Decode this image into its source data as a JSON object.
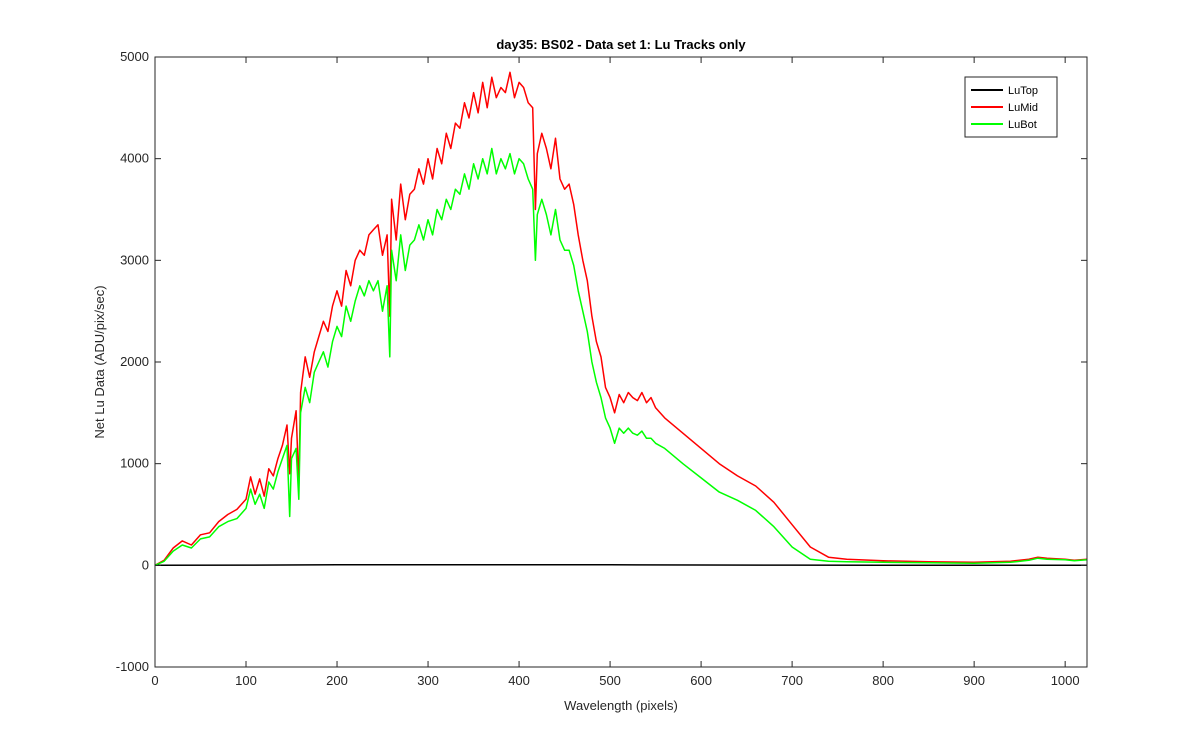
{
  "chart_data": {
    "type": "line",
    "title": "day35: BS02 - Data set 1: Lu Tracks only",
    "xlabel": "Wavelength (pixels)",
    "ylabel": "Net Lu Data (ADU/pix/sec)",
    "xlim": [
      0,
      1024
    ],
    "ylim": [
      -1000,
      5000
    ],
    "xticks": [
      0,
      100,
      200,
      300,
      400,
      500,
      600,
      700,
      800,
      900,
      1000
    ],
    "yticks": [
      -1000,
      0,
      1000,
      2000,
      3000,
      4000,
      5000
    ],
    "grid": false,
    "legend_position": "top-right",
    "series": [
      {
        "name": "LuTop",
        "color": "#000000",
        "x": [
          0,
          100,
          200,
          300,
          400,
          500,
          600,
          700,
          800,
          900,
          1024
        ],
        "y": [
          0,
          2,
          5,
          6,
          6,
          5,
          3,
          2,
          1,
          1,
          1
        ]
      },
      {
        "name": "LuMid",
        "color": "#ff0000",
        "x": [
          0,
          10,
          20,
          30,
          40,
          50,
          60,
          70,
          80,
          90,
          100,
          105,
          110,
          115,
          120,
          125,
          130,
          135,
          140,
          145,
          148,
          150,
          155,
          158,
          160,
          165,
          170,
          175,
          180,
          185,
          190,
          195,
          200,
          205,
          210,
          215,
          220,
          225,
          230,
          235,
          240,
          245,
          250,
          255,
          258,
          260,
          265,
          270,
          275,
          280,
          285,
          290,
          295,
          300,
          305,
          310,
          315,
          320,
          325,
          330,
          335,
          340,
          345,
          350,
          355,
          360,
          365,
          370,
          375,
          380,
          385,
          390,
          395,
          400,
          405,
          410,
          415,
          418,
          420,
          425,
          430,
          435,
          440,
          445,
          450,
          455,
          460,
          465,
          470,
          475,
          480,
          485,
          490,
          495,
          500,
          505,
          510,
          515,
          520,
          525,
          530,
          535,
          540,
          545,
          550,
          560,
          580,
          600,
          620,
          640,
          660,
          680,
          700,
          720,
          740,
          760,
          800,
          850,
          900,
          940,
          960,
          970,
          980,
          1000,
          1010,
          1024
        ],
        "y": [
          0,
          50,
          170,
          240,
          200,
          300,
          320,
          430,
          500,
          550,
          650,
          870,
          700,
          850,
          680,
          950,
          880,
          1050,
          1180,
          1380,
          900,
          1250,
          1520,
          780,
          1700,
          2050,
          1850,
          2100,
          2250,
          2400,
          2300,
          2550,
          2700,
          2550,
          2900,
          2750,
          3000,
          3100,
          3050,
          3250,
          3300,
          3350,
          3050,
          3250,
          2450,
          3600,
          3200,
          3750,
          3400,
          3650,
          3700,
          3900,
          3750,
          4000,
          3800,
          4100,
          3950,
          4250,
          4100,
          4350,
          4300,
          4550,
          4400,
          4650,
          4450,
          4750,
          4500,
          4800,
          4600,
          4700,
          4650,
          4850,
          4600,
          4750,
          4700,
          4550,
          4500,
          3500,
          4050,
          4250,
          4100,
          3900,
          4200,
          3800,
          3700,
          3750,
          3550,
          3250,
          3000,
          2800,
          2450,
          2200,
          2050,
          1750,
          1650,
          1500,
          1680,
          1600,
          1700,
          1650,
          1620,
          1700,
          1600,
          1650,
          1550,
          1450,
          1300,
          1150,
          1000,
          880,
          780,
          620,
          400,
          180,
          80,
          60,
          45,
          35,
          30,
          40,
          60,
          80,
          70,
          60,
          50,
          60
        ]
      },
      {
        "name": "LuBot",
        "color": "#00ff00",
        "x": [
          0,
          10,
          20,
          30,
          40,
          50,
          60,
          70,
          80,
          90,
          100,
          105,
          110,
          115,
          120,
          125,
          130,
          135,
          140,
          145,
          148,
          150,
          155,
          158,
          160,
          165,
          170,
          175,
          180,
          185,
          190,
          195,
          200,
          205,
          210,
          215,
          220,
          225,
          230,
          235,
          240,
          245,
          250,
          255,
          258,
          260,
          265,
          270,
          275,
          280,
          285,
          290,
          295,
          300,
          305,
          310,
          315,
          320,
          325,
          330,
          335,
          340,
          345,
          350,
          355,
          360,
          365,
          370,
          375,
          380,
          385,
          390,
          395,
          400,
          405,
          410,
          415,
          418,
          420,
          425,
          430,
          435,
          440,
          445,
          450,
          455,
          460,
          465,
          470,
          475,
          480,
          485,
          490,
          495,
          500,
          505,
          510,
          515,
          520,
          525,
          530,
          535,
          540,
          545,
          550,
          560,
          580,
          600,
          620,
          640,
          660,
          680,
          700,
          720,
          740,
          760,
          800,
          850,
          900,
          940,
          960,
          970,
          980,
          1000,
          1010,
          1024
        ],
        "y": [
          0,
          40,
          140,
          200,
          170,
          260,
          280,
          380,
          430,
          460,
          560,
          750,
          600,
          700,
          560,
          820,
          750,
          920,
          1050,
          1180,
          480,
          1050,
          1150,
          650,
          1500,
          1750,
          1600,
          1900,
          2000,
          2100,
          1950,
          2200,
          2350,
          2250,
          2550,
          2400,
          2600,
          2750,
          2650,
          2800,
          2700,
          2800,
          2500,
          2750,
          2050,
          3100,
          2800,
          3250,
          2900,
          3150,
          3200,
          3350,
          3200,
          3400,
          3250,
          3500,
          3400,
          3600,
          3500,
          3700,
          3650,
          3850,
          3700,
          3950,
          3800,
          4000,
          3850,
          4100,
          3850,
          4000,
          3900,
          4050,
          3850,
          4000,
          3950,
          3800,
          3700,
          3000,
          3450,
          3600,
          3450,
          3250,
          3500,
          3200,
          3100,
          3100,
          2950,
          2700,
          2500,
          2300,
          2000,
          1800,
          1650,
          1450,
          1350,
          1200,
          1350,
          1300,
          1350,
          1300,
          1280,
          1320,
          1250,
          1250,
          1200,
          1150,
          1000,
          860,
          720,
          640,
          540,
          380,
          180,
          60,
          40,
          35,
          30,
          25,
          20,
          30,
          50,
          70,
          60,
          55,
          45,
          55
        ]
      }
    ]
  }
}
